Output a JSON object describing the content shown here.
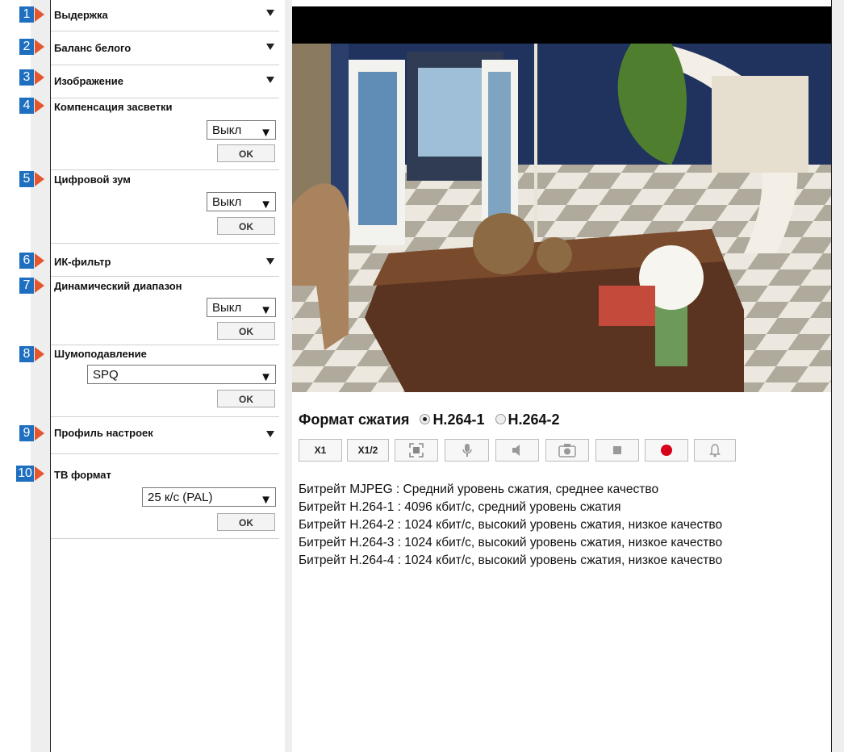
{
  "sections": [
    {
      "num": "1",
      "title": "Выдержка"
    },
    {
      "num": "2",
      "title": "Баланс белого"
    },
    {
      "num": "3",
      "title": "Изображение"
    },
    {
      "num": "4",
      "title": "Компенсация засветки",
      "select": "Выкл",
      "ok": "OK"
    },
    {
      "num": "5",
      "title": "Цифровой зум",
      "select": "Выкл",
      "ok": "OK"
    },
    {
      "num": "6",
      "title": "ИК-фильтр"
    },
    {
      "num": "7",
      "title": "Динамический диапазон",
      "select": "Выкл",
      "ok": "OK"
    },
    {
      "num": "8",
      "title": "Шумоподавление",
      "select": "SPQ",
      "ok": "OK"
    },
    {
      "num": "9",
      "title": "Профиль настроек"
    },
    {
      "num": "10",
      "title": "ТВ формат",
      "select": "25 к/с (PAL)",
      "ok": "OK"
    }
  ],
  "compression": {
    "label": "Формат сжатия",
    "options": [
      "H.264-1",
      "H.264-2"
    ],
    "selected": "H.264-1"
  },
  "toolbar": {
    "x1": "X1",
    "x12": "X1/2",
    "icons": [
      "fullscreen-icon",
      "microphone-icon",
      "speaker-icon",
      "camera-icon",
      "stop-icon",
      "record-icon",
      "bell-icon"
    ]
  },
  "bitrates": [
    "Битрейт MJPEG : Средний уровень сжатия, среднее качество",
    "Битрейт H.264-1 : 4096 кбит/с, средний уровень сжатия",
    "Битрейт H.264-2 : 1024 кбит/с, высокий уровень сжатия, низкое качество",
    "Битрейт H.264-3 : 1024 кбит/с, высокий уровень сжатия, низкое качество",
    "Битрейт H.264-4 : 1024 кбит/с, высокий уровень сжатия, низкое качество"
  ],
  "colors": {
    "badge": "#1f6fc0",
    "arrow": "#e4572e",
    "record": "#d9001b"
  }
}
